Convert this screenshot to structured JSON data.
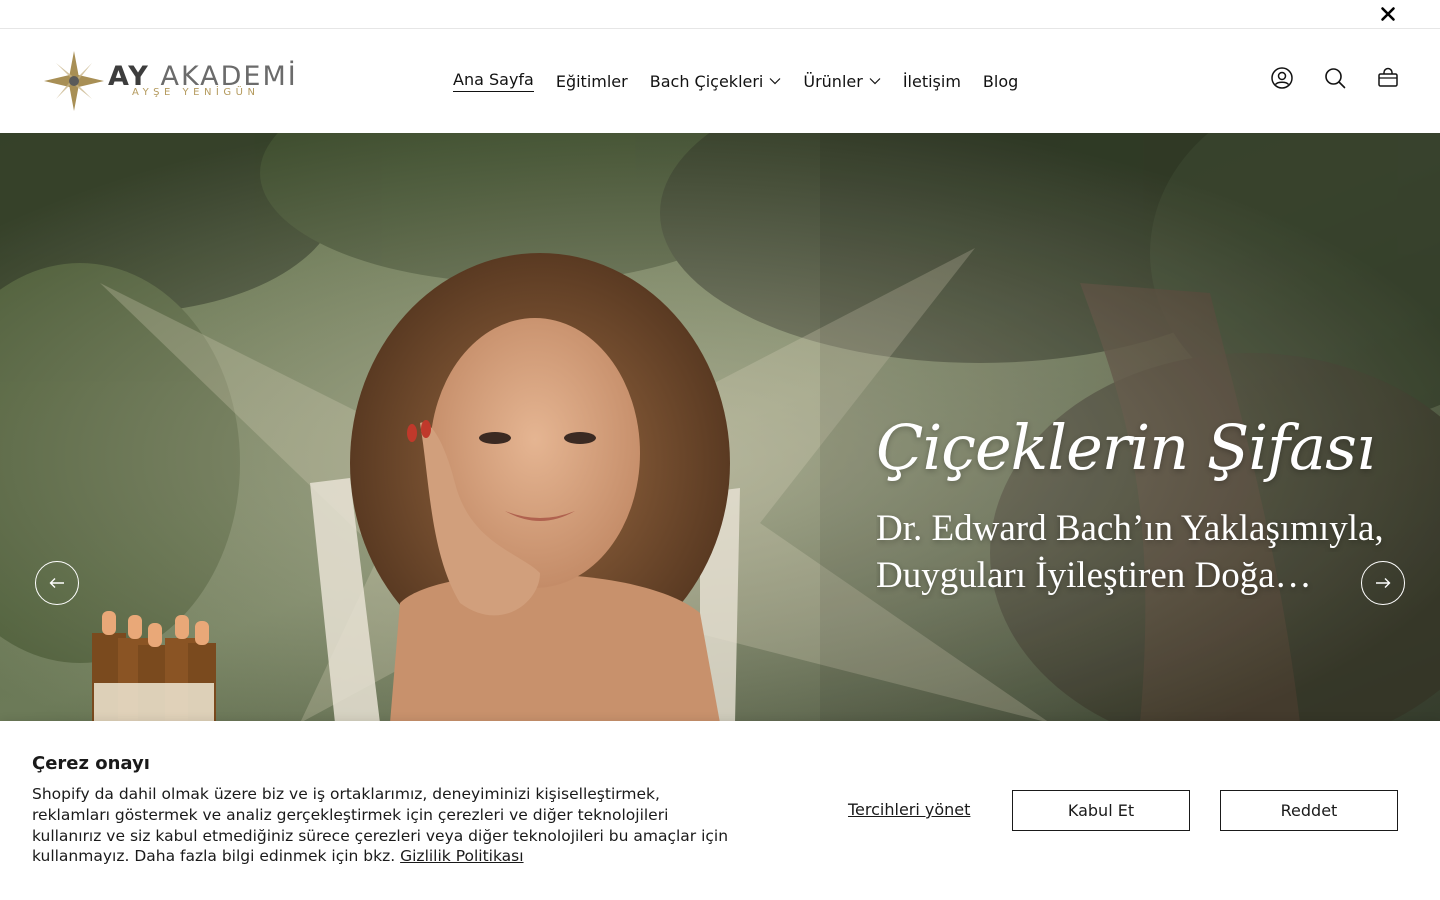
{
  "announcement": {
    "close_icon": "close-icon"
  },
  "brand": {
    "name_bold": "AY",
    "name_light": "AKADEMİ",
    "tagline": "AYŞE YENİGÜN",
    "logo_icon": "star-logo-icon",
    "accent_color": "#b49a5d"
  },
  "nav": {
    "items": [
      {
        "label": "Ana Sayfa",
        "active": true,
        "dropdown": false
      },
      {
        "label": "Eğitimler",
        "active": false,
        "dropdown": false
      },
      {
        "label": "Bach Çiçekleri",
        "active": false,
        "dropdown": true
      },
      {
        "label": "Ürünler",
        "active": false,
        "dropdown": true
      },
      {
        "label": "İletişim",
        "active": false,
        "dropdown": false
      },
      {
        "label": "Blog",
        "active": false,
        "dropdown": false
      }
    ]
  },
  "header_icons": [
    "account-icon",
    "search-icon",
    "cart-icon"
  ],
  "hero": {
    "title": "Çiçeklerin Şifası",
    "subtitle_line1": "Dr. Edward Bach’ın Yaklaşımıyla,",
    "subtitle_line2": "Duyguları İyileştiren Doğa…",
    "prev_icon": "arrow-left-icon",
    "next_icon": "arrow-right-icon"
  },
  "cookie": {
    "title": "Çerez onayı",
    "text": "Shopify da dahil olmak üzere biz ve iş ortaklarımız, deneyiminizi kişiselleştirmek, reklamları göstermek ve analiz gerçekleştirmek için çerezleri ve diğer teknolojileri kullanırız ve siz kabul etmediğiniz sürece çerezleri veya diğer teknolojileri bu amaçlar için kullanmayız. Daha fazla bilgi edinmek için bkz.",
    "policy_link": "Gizlilik Politikası",
    "manage": "Tercihleri yönet",
    "accept": "Kabul Et",
    "reject": "Reddet"
  }
}
